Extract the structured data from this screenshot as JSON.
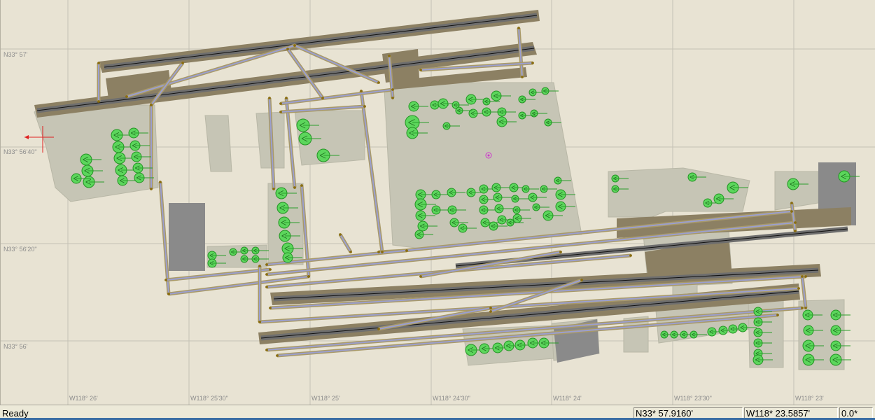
{
  "map": {
    "lat_labels": [
      "N33° 57'",
      "N33° 56'40\"",
      "N33° 56'20\"",
      "N33° 56'"
    ],
    "lon_labels": [
      "W118° 26'",
      "W118° 25'30\"",
      "W118° 25'",
      "W118° 24'30\"",
      "W118° 24'",
      "W118° 23'30\"",
      "W118° 23'"
    ],
    "colors": {
      "background": "#e8e3d3",
      "grid": "#c4c1b6",
      "ground_area": "#c6c5b5",
      "building": "#8a8a8a",
      "runway_shoulder": "#8c8063",
      "runway": "#6e6e6e",
      "taxiway_edge": "#a89968",
      "taxiway_line": "#9b9fcf",
      "gate_line": "#2a9d2a",
      "gate_fill": "#5cd65c",
      "gate_stroke": "#239423",
      "node": "#8a6d10"
    }
  },
  "statusbar": {
    "status": "Ready",
    "latitude": "N33* 57.9160'",
    "longitude": "W118* 23.5857'",
    "heading": "0.0*"
  }
}
